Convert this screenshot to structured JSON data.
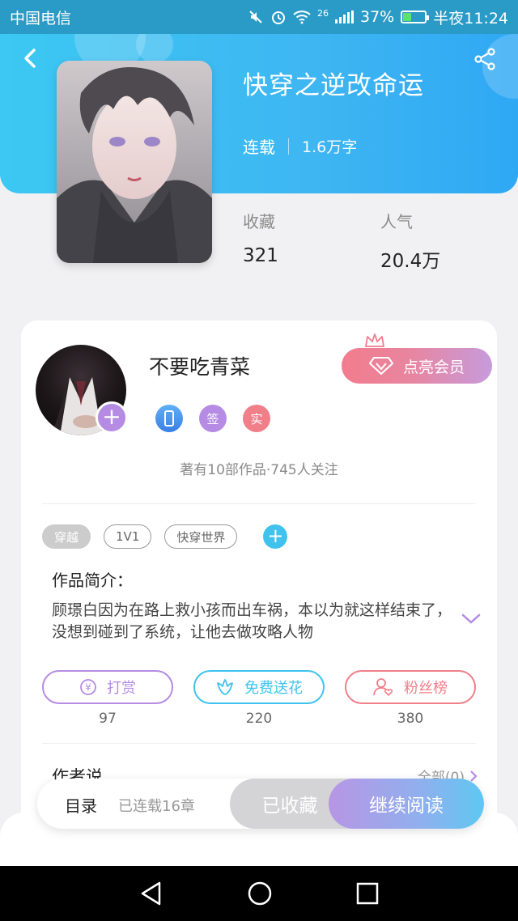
{
  "status_bar": {
    "carrier": "中国电信",
    "network": "26",
    "battery": "37%",
    "battery_level": 0.37,
    "time": "半夜11:24"
  },
  "book": {
    "title": "快穿之逆改命运",
    "status": "连载",
    "word_count": "1.6万字",
    "stats": [
      {
        "label": "收藏",
        "value": "321"
      },
      {
        "label": "人气",
        "value": "20.4万"
      }
    ]
  },
  "author": {
    "name": "不要吃青菜",
    "vip_label": "点亮会员",
    "badges": [
      {
        "icon": "phone-icon",
        "text": "",
        "color": "#4f9df2"
      },
      {
        "icon": "sign-badge",
        "text": "签",
        "color": "#b58be3"
      },
      {
        "icon": "real-badge",
        "text": "实",
        "color": "#f07f8a"
      }
    ],
    "works_info": "著有10部作品·745人关注"
  },
  "tags": [
    "穿越",
    "1V1",
    "快穿世界"
  ],
  "intro": {
    "title": "作品简介：",
    "text": "顾璟白因为在路上救小孩而出车祸，本以为就这样结束了，没想到碰到了系统，让他去做攻略人物"
  },
  "actions": [
    {
      "label": "打赏",
      "count": "97",
      "color": "#b58be3",
      "icon": "coin-icon"
    },
    {
      "label": "免费送花",
      "count": "220",
      "color": "#3fc3ee",
      "icon": "flower-icon"
    },
    {
      "label": "粉丝榜",
      "count": "380",
      "color": "#f07f8a",
      "icon": "fan-icon"
    }
  ],
  "author_says": {
    "title": "作者说",
    "all_label": "全部(0)"
  },
  "read_bar": {
    "toc_label": "目录",
    "chapters": "已连载16章",
    "saved_label": "已收藏",
    "continue_label": "继续阅读"
  },
  "colors": {
    "header": "#3cc8f2",
    "accent_purple": "#b58be3",
    "accent_pink": "#f07f8a",
    "accent_blue": "#3fc3ee"
  }
}
